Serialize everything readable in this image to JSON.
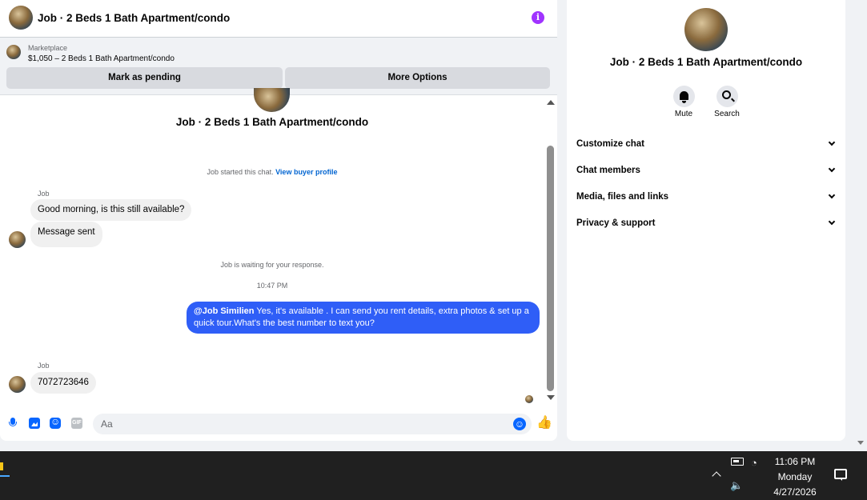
{
  "header": {
    "title": "Job · 2 Beds 1 Bath Apartment/condo"
  },
  "marketplace": {
    "label": "Marketplace",
    "listing": "$1,050 – 2 Beds 1 Bath Apartment/condo",
    "pending_label": "Mark as pending",
    "more_label": "More Options"
  },
  "conversation": {
    "title": "Job · 2 Beds 1 Bath Apartment/condo",
    "started_text": "Job started this chat.",
    "profile_link": "View buyer profile",
    "messages_in_1": {
      "sender": "Job",
      "text_1": "Good morning, is this still available?",
      "text_2": "Message sent"
    },
    "waiting_text": "Job is waiting for your response.",
    "timestamp": "10:47 PM",
    "outgoing": {
      "mention": "@Job Similien",
      "text": " Yes, it's available .  I can send you rent details, extra photos & set up a quick tour.What's the best number to text you?"
    },
    "messages_in_2": {
      "sender": "Job",
      "text": "7072723646"
    }
  },
  "composer": {
    "placeholder": "Aa",
    "gif_label": "GIF",
    "icons": [
      "microphone-icon",
      "image-icon",
      "sticker-icon",
      "gif-icon",
      "emoji-icon",
      "thumbs-up-icon"
    ]
  },
  "info_panel": {
    "title": "Job · 2 Beds 1 Bath Apartment/condo",
    "mute_label": "Mute",
    "search_label": "Search",
    "menu": [
      {
        "label": "Customize chat"
      },
      {
        "label": "Chat members"
      },
      {
        "label": "Media, files and links"
      },
      {
        "label": "Privacy & support"
      }
    ]
  },
  "taskbar": {
    "time": "11:06 PM",
    "day": "Monday",
    "date": "4/27/2026"
  },
  "colors": {
    "accent": "#0866ff",
    "outgoing_bubble": "#2f5ef7",
    "info_icon": "#a033ff"
  }
}
